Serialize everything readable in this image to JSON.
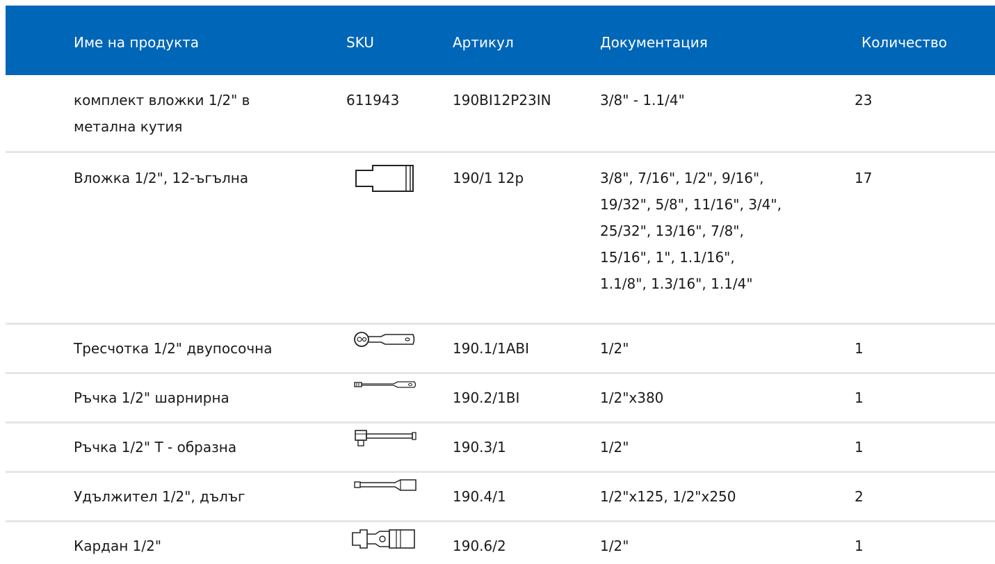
{
  "table": {
    "headers": {
      "name": "Име на продукта",
      "sku": "SKU",
      "article": "Артикул",
      "documentation": "Документация",
      "quantity": "Количество"
    },
    "rows": [
      {
        "name_line1": "комплект вложки 1/2\" в",
        "name_line2": "метална кутия",
        "sku": "611943",
        "sku_icon": "",
        "article": "190BI12P23IN",
        "doc_lines": [
          "3/8\" - 1.1/4\""
        ],
        "quantity": "23"
      },
      {
        "name_line1": "Вложка 1/2\", 12-ъгълна",
        "sku_icon": "socket-icon",
        "article": "190/1 12p",
        "doc_lines": [
          "3/8\", 7/16\", 1/2\", 9/16\",",
          "19/32\", 5/8\", 11/16\", 3/4\",",
          "25/32\", 13/16\", 7/8\",",
          "15/16\", 1\", 1.1/16\",",
          "1.1/8\", 1.3/16\", 1.1/4\""
        ],
        "quantity": "17"
      },
      {
        "name_line1": "Тресчотка 1/2\" двупосочна",
        "sku_icon": "ratchet-icon",
        "article": "190.1/1ABI",
        "doc_lines": [
          "1/2\""
        ],
        "quantity": "1"
      },
      {
        "name_line1": "Ръчка 1/2\" шарнирна",
        "sku_icon": "hinged-handle-icon",
        "article": "190.2/1BI",
        "doc_lines": [
          "1/2\"x380"
        ],
        "quantity": "1"
      },
      {
        "name_line1": "Ръчка 1/2\" Т - образна",
        "sku_icon": "t-handle-icon",
        "article": "190.3/1",
        "doc_lines": [
          "1/2\""
        ],
        "quantity": "1"
      },
      {
        "name_line1": "Удължител 1/2\", дълъг",
        "sku_icon": "extension-bar-icon",
        "article": "190.4/1",
        "doc_lines": [
          "1/2\"x125, 1/2\"x250"
        ],
        "quantity": "2"
      },
      {
        "name_line1": "Кардан 1/2\"",
        "sku_icon": "universal-joint-icon",
        "article": "190.6/2",
        "doc_lines": [
          "1/2\""
        ],
        "quantity": "1"
      }
    ]
  },
  "colors": {
    "header_bg": "#0066b8",
    "header_text": "#ffffff",
    "row_divider": "#e6e6e6",
    "text": "#1a1a1a"
  }
}
